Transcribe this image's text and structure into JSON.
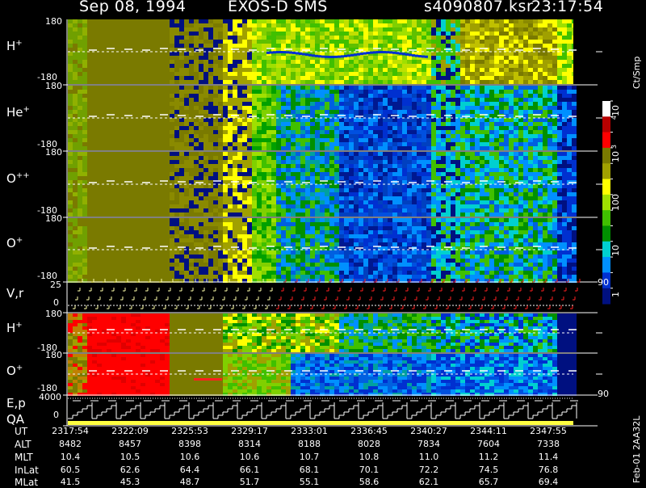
{
  "header": {
    "date": "Sep 08, 1994",
    "instrument": "EXOS-D SMS",
    "file": "s4090807.ksr",
    "time": "23:17:54"
  },
  "panels": [
    {
      "label_main": "H",
      "label_sup": "+",
      "top_tick": "180",
      "bottom_tick": "-180"
    },
    {
      "label_main": "He",
      "label_sup": "+",
      "top_tick": "180",
      "bottom_tick": "-180"
    },
    {
      "label_main": "O",
      "label_sup": "++",
      "top_tick": "180",
      "bottom_tick": "-180"
    },
    {
      "label_main": "O",
      "label_sup": "+",
      "top_tick": "180",
      "bottom_tick": "-180"
    }
  ],
  "vr_panel": {
    "label": "V,r",
    "top_tick": "25",
    "mid_tick": "0",
    "right_tick": "90"
  },
  "lower_panels": [
    {
      "label_main": "H",
      "label_sup": "+",
      "top_tick": "180",
      "bottom_tick": "-180"
    },
    {
      "label_main": "O",
      "label_sup": "+",
      "top_tick": "180",
      "bottom_tick": "-180"
    }
  ],
  "ep_panel": {
    "label": "E,p",
    "qa_label": "QA",
    "top_tick": "4000",
    "mid_tick": "0",
    "right_tick": "90"
  },
  "colorbar": {
    "unit": "Ct/Smp",
    "labels": [
      "10",
      "4",
      "10",
      "3",
      "100",
      "10",
      "1"
    ],
    "colors": [
      "#ffffff",
      "#b80000",
      "#ff0000",
      "#7a7a00",
      "#a0a000",
      "#ffff00",
      "#a0e000",
      "#40c000",
      "#009000",
      "#00d0d0",
      "#0090ff",
      "#0030d0",
      "#001080"
    ]
  },
  "table": {
    "rows": [
      {
        "name": "UT",
        "values": [
          "2317:54",
          "2322:09",
          "2325:53",
          "2329:17",
          "2333:01",
          "2336:45",
          "2340:27",
          "2344:11",
          "2347:55"
        ]
      },
      {
        "name": "ALT",
        "values": [
          "8482",
          "8457",
          "8398",
          "8314",
          "8188",
          "8028",
          "7834",
          "7604",
          "7338"
        ]
      },
      {
        "name": "MLT",
        "values": [
          "10.4",
          "10.5",
          "10.6",
          "10.6",
          "10.7",
          "10.8",
          "11.0",
          "11.2",
          "11.4"
        ]
      },
      {
        "name": "InLat",
        "values": [
          "60.5",
          "62.6",
          "64.4",
          "66.1",
          "68.1",
          "70.1",
          "72.2",
          "74.5",
          "76.8"
        ]
      },
      {
        "name": "MLat",
        "values": [
          "41.5",
          "45.3",
          "48.7",
          "51.7",
          "55.1",
          "58.6",
          "62.1",
          "65.7",
          "69.4"
        ]
      }
    ]
  },
  "footer_id": "Feb-01 2AA32L",
  "chart_data": {
    "type": "heatmap",
    "title": "Sep 08, 1994   EXOS-D SMS",
    "x_tick_labels": [
      "2317:54",
      "2322:09",
      "2325:53",
      "2329:17",
      "2333:01",
      "2336:45",
      "2340:27",
      "2344:11",
      "2347:55"
    ],
    "y_range_pitch": [
      -180,
      180
    ],
    "colorbar_unit": "Ct/Smp",
    "colorbar_range": [
      1,
      10000
    ]
  }
}
